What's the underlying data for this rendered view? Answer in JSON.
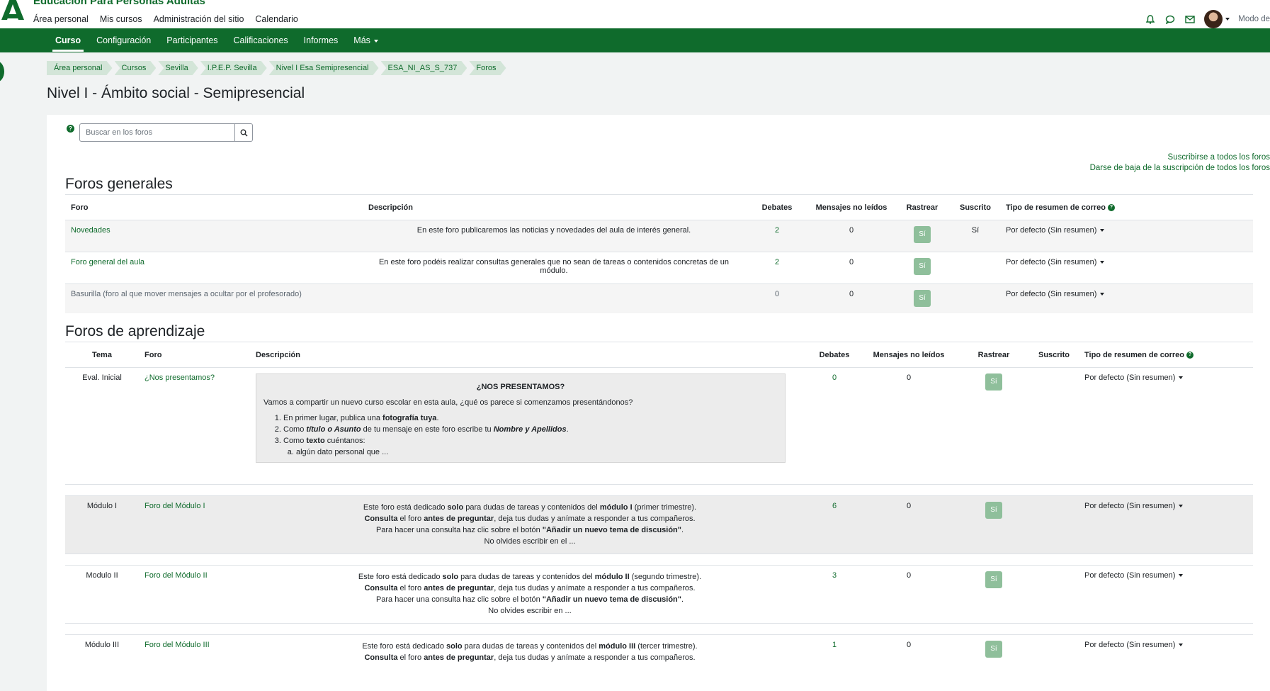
{
  "site": {
    "name": "Educación Para Personas Adultas"
  },
  "primary_nav": [
    "Área personal",
    "Mis cursos",
    "Administración del sitio",
    "Calendario"
  ],
  "user_tools": {
    "edit_mode_label": "Modo de"
  },
  "secondary_nav": [
    "Curso",
    "Configuración",
    "Participantes",
    "Calificaciones",
    "Informes",
    "Más"
  ],
  "breadcrumb": [
    "Área personal",
    "Cursos",
    "Sevilla",
    "I.P.E.P. Sevilla",
    "Nivel I Esa Semipresencial",
    "ESA_NI_AS_S_737",
    "Foros"
  ],
  "page_title": "Nivel I - Ámbito social - Semipresencial",
  "search": {
    "placeholder": "Buscar en los foros"
  },
  "subscription_links": {
    "subscribe_all": "Suscribirse a todos los foros",
    "unsubscribe_all": "Darse de baja de la suscripción de todos los foros"
  },
  "general_forums": {
    "title": "Foros generales",
    "headers": [
      "Foro",
      "Descripción",
      "Debates",
      "Mensajes no leídos",
      "Rastrear",
      "Suscrito",
      "Tipo de resumen de correo"
    ],
    "rows": [
      {
        "forum": "Novedades",
        "description": "En este foro publicaremos las noticias y novedades del aula de interés general.",
        "debates": "2",
        "unread": "0",
        "track": "Sí",
        "subscribed": "Sí",
        "digest": "Por defecto (Sin resumen)"
      },
      {
        "forum": "Foro general del aula",
        "description": "En este foro podéis realizar consultas generales que no sean de tareas o contenidos concretas de un módulo.",
        "debates": "2",
        "unread": "0",
        "track": "Sí",
        "subscribed": "",
        "digest": "Por defecto (Sin resumen)"
      },
      {
        "forum": "Basurilla (foro al que mover mensajes a ocultar por el profesorado)",
        "description": "",
        "debates": "0",
        "unread": "0",
        "track": "Sí",
        "subscribed": "",
        "digest": "Por defecto (Sin resumen)"
      }
    ]
  },
  "learning_forums": {
    "title": "Foros de aprendizaje",
    "headers": [
      "Tema",
      "Foro",
      "Descripción",
      "Debates",
      "Mensajes no leídos",
      "Rastrear",
      "Suscrito",
      "Tipo de resumen de correo"
    ],
    "intro_row": {
      "topic": "Eval. Inicial",
      "forum": "¿Nos presentamos?",
      "desc_title": "¿NOS PRESENTAMOS?",
      "desc_intro": "Vamos a compartir un nuevo curso escolar en esta aula, ¿qué os parece si comenzamos presentándonos?",
      "step1_pre": "En primer lugar, publica una ",
      "step1_bold": "fotografía tuya",
      "step1_post": ".",
      "step2_pre": "Como ",
      "step2_bold": "título o Asunto",
      "step2_mid": " de tu mensaje en este foro escribe tu ",
      "step2_bold2": "Nombre y Apellidos",
      "step2_post": ".",
      "step3_pre": "Como ",
      "step3_bold": "texto",
      "step3_post": " cuéntanos:",
      "step3a": "algún dato personal que ...",
      "debates": "0",
      "unread": "0",
      "track": "Sí",
      "digest": "Por defecto (Sin resumen)"
    },
    "modules": [
      {
        "topic": "Módulo I",
        "forum": "Foro del Módulo I",
        "l1_pre": "Este foro está dedicado ",
        "l1_b1": "solo",
        "l1_mid": " para dudas de tareas y contenidos del ",
        "l1_b2": "módulo I",
        "l1_post": " (primer trimestre).",
        "l2_b1": "Consulta",
        "l2_mid": " el foro ",
        "l2_b2": "antes de preguntar",
        "l2_post": ", deja tus dudas y anímate a responder a tus compañeros.",
        "l3_pre": "Para hacer una consulta haz clic sobre el botón ",
        "l3_b": "\"Añadir un nuevo tema de discusión\"",
        "l3_post": ".",
        "l4": "No olvides escribir en el ...",
        "debates": "6",
        "unread": "0",
        "track": "Sí",
        "digest": "Por defecto (Sin resumen)"
      },
      {
        "topic": "Modulo II",
        "forum": "Foro del Módulo II",
        "l1_pre": "Este foro está dedicado ",
        "l1_b1": "solo",
        "l1_mid": " para dudas de tareas y contenidos del ",
        "l1_b2": "módulo II",
        "l1_post": " (segundo trimestre).",
        "l2_b1": "Consulta",
        "l2_mid": " el foro ",
        "l2_b2": "antes de preguntar",
        "l2_post": ", deja tus dudas y anímate a responder a tus compañeros.",
        "l3_pre": "Para hacer una consulta haz clic sobre el botón ",
        "l3_b": "\"Añadir un nuevo tema de discusión\"",
        "l3_post": ".",
        "l4": "No olvides escribir en ...",
        "debates": "3",
        "unread": "0",
        "track": "Sí",
        "digest": "Por defecto (Sin resumen)"
      },
      {
        "topic": "Módulo III",
        "forum": "Foro del Módulo III",
        "l1_pre": "Este foro está dedicado ",
        "l1_b1": "solo",
        "l1_mid": " para dudas de tareas y contenidos del ",
        "l1_b2": "módulo III",
        "l1_post": " (tercer trimestre).",
        "l2_b1": "Consulta",
        "l2_mid": " el foro ",
        "l2_b2": "antes de preguntar",
        "l2_post": ", deja tus dudas y anímate a responder a tus compañeros.",
        "l3_pre": "",
        "l3_b": "",
        "l3_post": "",
        "l4": "",
        "debates": "1",
        "unread": "0",
        "track": "Sí",
        "digest": "Por defecto (Sin resumen)"
      }
    ]
  },
  "colors": {
    "brand": "#0f6b2c",
    "breadcrumb_bg": "#d3e5d8",
    "track_button": "#8fbf9b"
  },
  "icons": [
    "logo-icon",
    "bell-icon",
    "chat-icon",
    "mail-icon",
    "help-icon",
    "search-icon",
    "caret-down-icon"
  ]
}
